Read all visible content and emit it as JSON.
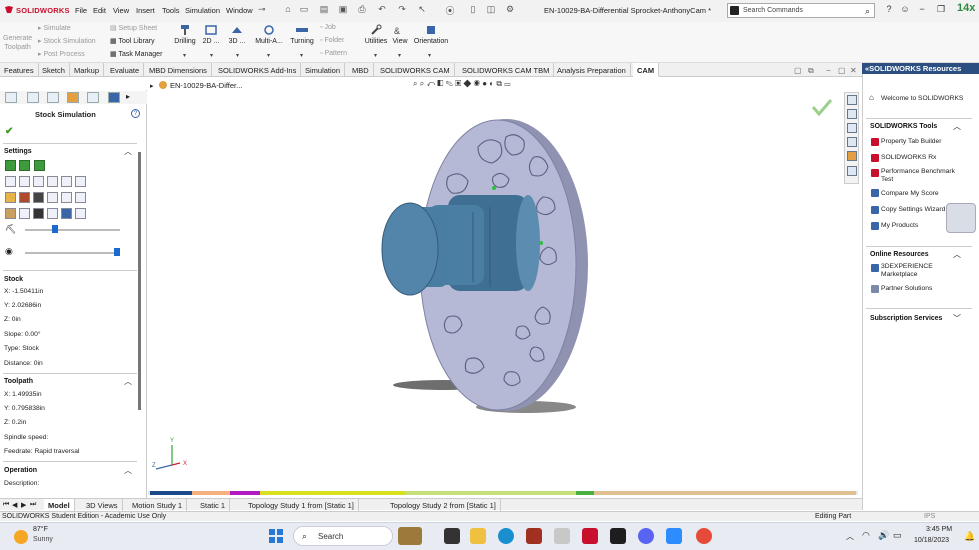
{
  "app": {
    "logo_text": "SOLIDWORKS",
    "document_title": "EN-10029-BA-Differential Sprocket-AnthonyCam *",
    "search_placeholder": "Search Commands",
    "badge_text": "14x"
  },
  "menu": [
    "File",
    "Edit",
    "View",
    "Insert",
    "Tools",
    "Simulation",
    "Window"
  ],
  "cmd": {
    "generate_toolpath": [
      "Generate",
      "Toolpath"
    ],
    "simulate": "Simulate",
    "stock_simulation": "Stock Simulation",
    "post_process": "Post Process",
    "setup_sheet": "Setup Sheet",
    "tool_library": "Tool Library",
    "task_manager": "Task Manager",
    "drilling": "Drilling",
    "two_d": "2D ...",
    "three_d": "3D ...",
    "multi_axis": "Multi-A...",
    "turning": "Turning",
    "job": "Job",
    "folder": "Folder",
    "pattern": "Pattern",
    "utilities": "Utilities",
    "view": "View",
    "orientation": "Orientation"
  },
  "tabs": [
    "Features",
    "Sketch",
    "Markup",
    "Evaluate",
    "MBD Dimensions",
    "SOLIDWORKS Add-Ins",
    "Simulation",
    "MBD",
    "SOLIDWORKS CAM",
    "SOLIDWORKS CAM TBM",
    "Analysis Preparation",
    "CAM"
  ],
  "active_tab": "CAM",
  "panel": {
    "title": "Stock Simulation",
    "settings_label": "Settings",
    "stock": {
      "label": "Stock",
      "x": "X: -1.50411in",
      "y": "Y: 2.02686in",
      "z": "Z: 0in",
      "slope": "Slope: 0.00°",
      "type": "Type: Stock",
      "distance": "Distance: 0in"
    },
    "toolpath": {
      "label": "Toolpath",
      "x": "X: 1.49935in",
      "y": "Y: 0.795838in",
      "z": "Z: 0.2in",
      "spindle": "Spindle speed:",
      "feedrate": "Feedrate: Rapid traversal"
    },
    "operation": {
      "label": "Operation",
      "description": "Description:"
    }
  },
  "viewport": {
    "breadcrumb": "EN-10029-BA-Differ...",
    "axis_y": "Y",
    "axis_x": "X",
    "axis_z": "Z"
  },
  "bottom_tabs": [
    "Model",
    "3D Views",
    "Motion Study 1",
    "Static 1",
    "Topology Study 1 from [Static 1]",
    "Topology Study 2 from [Static 1]"
  ],
  "active_bottom_tab": "Model",
  "status": {
    "left": "SOLIDWORKS Student Edition - Academic Use Only",
    "mode": "Editing Part",
    "units": "IPS"
  },
  "taskpane": {
    "title": "SOLIDWORKS Resources",
    "welcome": "Welcome to SOLIDWORKS",
    "tools_label": "SOLIDWORKS Tools",
    "tools": [
      "Property Tab Builder",
      "SOLIDWORKS Rx",
      "Performance Benchmark Test",
      "Compare My Score",
      "Copy Settings Wizard",
      "My Products"
    ],
    "online_label": "Online Resources",
    "online": [
      "3DEXPERIENCE Marketplace",
      "Partner Solutions"
    ],
    "subscription_label": "Subscription Services"
  },
  "taskbar": {
    "temperature": "87°F",
    "weather": "Sunny",
    "search": "Search",
    "time": "3:45 PM",
    "date": "10/18/2023"
  },
  "colors": {
    "brand_red": "#c8102e",
    "taskpane_header": "#2b4f81",
    "part_metal": "#b6b9d6",
    "stock_blue": "#4a7da2",
    "ok_green": "#3a9d23"
  }
}
